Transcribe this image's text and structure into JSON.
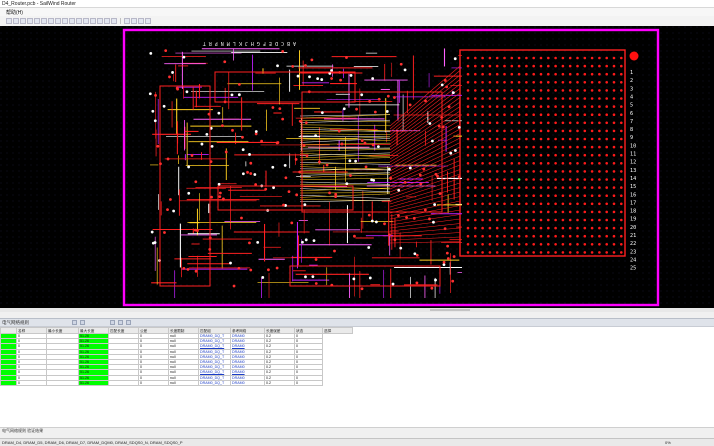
{
  "window": {
    "title": "D4_Router.pcb - SailWind Router"
  },
  "menu": {
    "items": [
      "帮助(H)"
    ]
  },
  "board": {
    "column_letters": "A B C D E F G H J K L M N P R T",
    "row_numbers": [
      "1",
      "2",
      "3",
      "4",
      "5",
      "6",
      "7",
      "8",
      "9",
      "10",
      "11",
      "12",
      "13",
      "14",
      "15",
      "16",
      "17",
      "18",
      "19",
      "20",
      "21",
      "22",
      "23",
      "24",
      "25"
    ]
  },
  "panel": {
    "title": "电气网络规则"
  },
  "table": {
    "columns": [
      "名称",
      "最小长度",
      "最大长度",
      "匹配长度",
      "公差",
      "长度限制",
      "匹配组",
      "参考网络",
      "长度误差",
      "状态",
      "选择"
    ],
    "rows": [
      [
        "0",
        "",
        "51.26",
        "",
        "0",
        "null",
        "DRAM0_DQ_T",
        "DRAM0",
        "0.2",
        "0"
      ],
      [
        "0",
        "",
        "51.26",
        "",
        "0",
        "null",
        "DRAM0_DQ_T",
        "DRAM0",
        "0.2",
        "0"
      ],
      [
        "0",
        "",
        "51.26",
        "",
        "0",
        "null",
        "DRAM0_DQ_T",
        "DRAM0",
        "0.2",
        "0"
      ],
      [
        "0",
        "",
        "51.26",
        "",
        "0",
        "null",
        "DRAM0_DQ_T",
        "DRAM0",
        "0.2",
        "0"
      ],
      [
        "0",
        "",
        "51.26",
        "",
        "0",
        "null",
        "DRAM0_DQ_T",
        "DRAM0",
        "0.2",
        "0"
      ],
      [
        "0",
        "",
        "51.26",
        "",
        "0",
        "null",
        "DRAM0_DQ_T",
        "DRAM0",
        "0.2",
        "0"
      ],
      [
        "0",
        "",
        "51.26",
        "",
        "0",
        "null",
        "DRAM0_DQ_T",
        "DRAM0",
        "0.2",
        "0"
      ],
      [
        "0",
        "",
        "51.26",
        "",
        "0",
        "null",
        "DRAM0_DQ_T",
        "DRAM0",
        "0.2",
        "0"
      ],
      [
        "0",
        "",
        "51.26",
        "",
        "0",
        "null",
        "DRAM0_DQ_T",
        "DRAM0",
        "0.2",
        "0"
      ],
      [
        "0",
        "",
        "51.26",
        "",
        "0",
        "null",
        "DRAM0_DQ_T",
        "DRAM0",
        "0.2",
        "0"
      ]
    ]
  },
  "status_line": "电气网络规则 验证结果",
  "status": {
    "nets": "DRAM_D4, DRAM_D5, DRAM_D6, DRAM_D7, DRAM_DQM0, DRAM_SDQS0_N, DRAM_SDQS0_P",
    "progress": "0%"
  },
  "colors": {
    "board_outline": "#ff00ff",
    "keepout": "#ff0000",
    "route": "#ff2020",
    "pad": "#ff1a1a"
  }
}
